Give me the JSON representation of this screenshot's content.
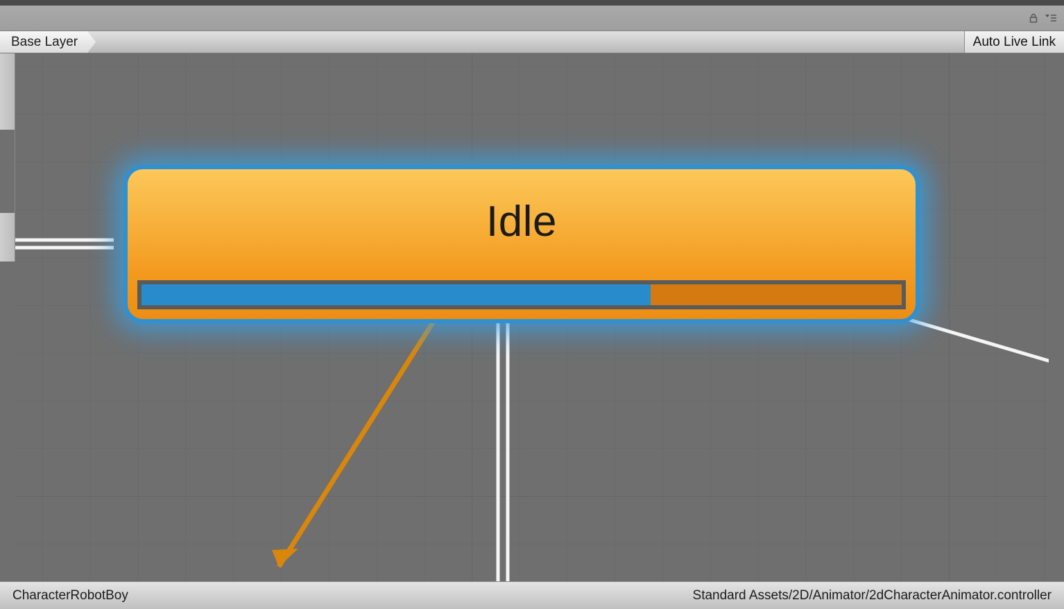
{
  "toolbar": {
    "lock_icon": "lock-icon",
    "options_icon": "options-icon"
  },
  "breadcrumb": {
    "layer": "Base Layer"
  },
  "header_buttons": {
    "auto_live_link": "Auto Live Link"
  },
  "state": {
    "name": "Idle",
    "progress_percent": 67
  },
  "status": {
    "object_name": "CharacterRobotBoy",
    "controller_path": "Standard Assets/2D/Animator/2dCharacterAnimator.controller"
  },
  "colors": {
    "node_gradient_top": "#fcc85a",
    "node_gradient_bottom": "#ec8e14",
    "selection_glow": "#2f90d2",
    "progress_fill": "#288ccc",
    "progress_track": "#d47a10",
    "graph_bg": "#6f6f6f"
  }
}
